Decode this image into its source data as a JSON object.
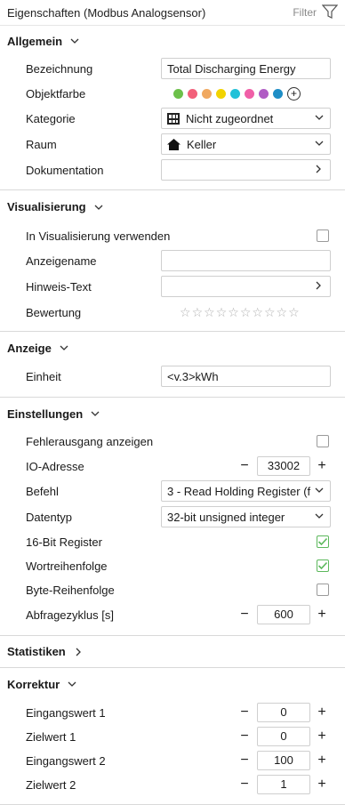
{
  "header": {
    "title": "Eigenschaften (Modbus Analogsensor)",
    "filter_label": "Filter"
  },
  "sections": {
    "allgemein": {
      "title": "Allgemein",
      "bezeichnung_label": "Bezeichnung",
      "bezeichnung_value": "Total Discharging Energy",
      "objektfarbe_label": "Objektfarbe",
      "colors": [
        "#6cc04a",
        "#f2607a",
        "#f0a860",
        "#f2d300",
        "#22c1d8",
        "#f05fa7",
        "#b05cc4",
        "#1e8ec6"
      ],
      "kategorie_label": "Kategorie",
      "kategorie_value": "Nicht zugeordnet",
      "raum_label": "Raum",
      "raum_value": "Keller",
      "dokumentation_label": "Dokumentation"
    },
    "visualisierung": {
      "title": "Visualisierung",
      "in_vis_label": "In Visualisierung verwenden",
      "anzeigename_label": "Anzeigename",
      "hinweis_label": "Hinweis-Text",
      "bewertung_label": "Bewertung",
      "star_count": 10
    },
    "anzeige": {
      "title": "Anzeige",
      "einheit_label": "Einheit",
      "einheit_value": "<v.3>kWh"
    },
    "einstellungen": {
      "title": "Einstellungen",
      "fehler_label": "Fehlerausgang anzeigen",
      "io_label": "IO-Adresse",
      "io_value": "33002",
      "befehl_label": "Befehl",
      "befehl_value": "3 - Read Holding Register (f",
      "datentyp_label": "Datentyp",
      "datentyp_value": "32-bit unsigned integer",
      "bit16_label": "16-Bit Register",
      "wort_label": "Wortreihenfolge",
      "byte_label": "Byte-Reihenfolge",
      "abfrage_label": "Abfragezyklus [s]",
      "abfrage_value": "600"
    },
    "statistiken": {
      "title": "Statistiken"
    },
    "korrektur": {
      "title": "Korrektur",
      "eingang1_label": "Eingangswert 1",
      "eingang1_value": "0",
      "ziel1_label": "Zielwert 1",
      "ziel1_value": "0",
      "eingang2_label": "Eingangswert 2",
      "eingang2_value": "100",
      "ziel2_label": "Zielwert 2",
      "ziel2_value": "1"
    }
  },
  "icons": {
    "minus": "−",
    "plus": "+"
  },
  "accent_check": "#5cb85c"
}
